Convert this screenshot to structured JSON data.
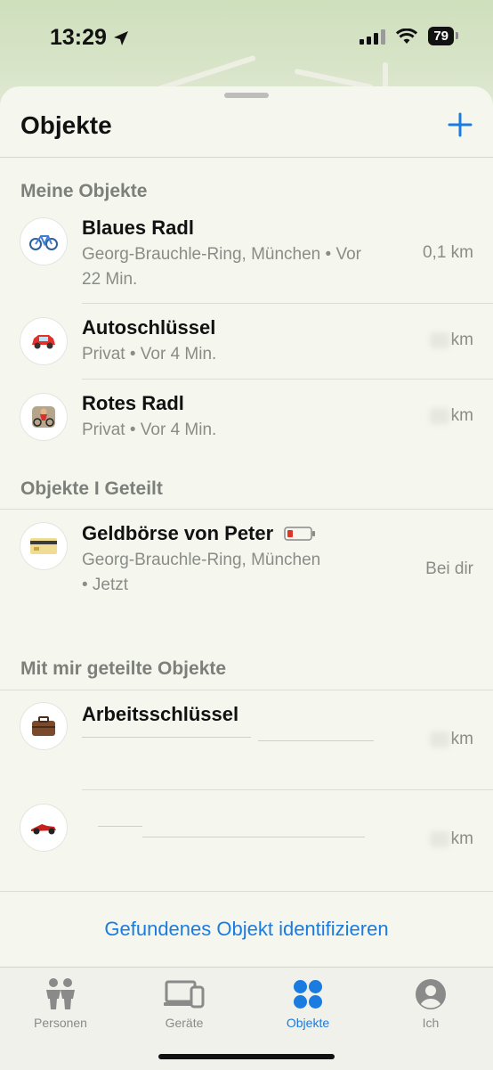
{
  "status_bar": {
    "time": "13:29",
    "battery": "79"
  },
  "header": {
    "title": "Objekte"
  },
  "sections": {
    "mine": {
      "title": "Meine Objekte",
      "items": [
        {
          "name": "Blaues Radl",
          "subtitle_line1": "Georg-Brauchle-Ring, München • Vor",
          "subtitle_line2": "22 Min.",
          "distance": "0,1 km",
          "icon": "bicycle-icon"
        },
        {
          "name": "Autoschlüssel",
          "subtitle_line1": "Privat • Vor 4 Min.",
          "distance": "km",
          "icon": "car-icon"
        },
        {
          "name": "Rotes Radl",
          "subtitle_line1": "Privat • Vor 4 Min.",
          "distance": "km",
          "icon": "cyclist-icon"
        }
      ]
    },
    "shared_by_me": {
      "title": "Objekte I Geteilt",
      "items": [
        {
          "name": "Geldbörse von Peter",
          "subtitle_line1": "Georg-Brauchle-Ring, München",
          "subtitle_line2": "• Jetzt",
          "distance": "Bei dir",
          "icon": "credit-card-icon"
        }
      ]
    },
    "shared_with_me": {
      "title": "Mit mir geteilte Objekte",
      "items": [
        {
          "name": "Arbeitsschlüssel",
          "distance": "km",
          "icon": "briefcase-icon"
        },
        {
          "name": "",
          "distance": "km",
          "icon": "race-car-icon"
        }
      ]
    }
  },
  "identify_link": "Gefundenes Objekt identifizieren",
  "tabs": [
    {
      "label": "Personen",
      "icon": "people-icon"
    },
    {
      "label": "Geräte",
      "icon": "devices-icon"
    },
    {
      "label": "Objekte",
      "icon": "items-icon",
      "active": true
    },
    {
      "label": "Ich",
      "icon": "person-circle-icon"
    }
  ],
  "colors": {
    "accent": "#1a7be0",
    "battery_low": "#e0342b"
  }
}
